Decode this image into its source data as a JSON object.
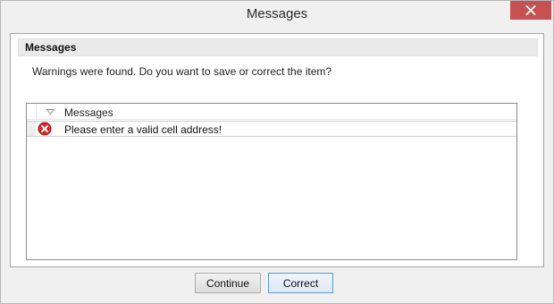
{
  "window": {
    "title": "Messages",
    "close_icon": "close-icon"
  },
  "group": {
    "header": "Messages",
    "prompt": "Warnings were found.  Do you want to save or correct the item?"
  },
  "list": {
    "sort_icon": "sort-triangle-icon",
    "column_header": "Messages",
    "rows": [
      {
        "icon": "error-icon",
        "text": "Please enter a valid cell address!"
      }
    ]
  },
  "buttons": {
    "continue_label": "Continue",
    "correct_label": "Correct"
  },
  "colors": {
    "close_button": "#c75050",
    "error_icon": "#e02424",
    "focus_border": "#5c9bd5"
  }
}
